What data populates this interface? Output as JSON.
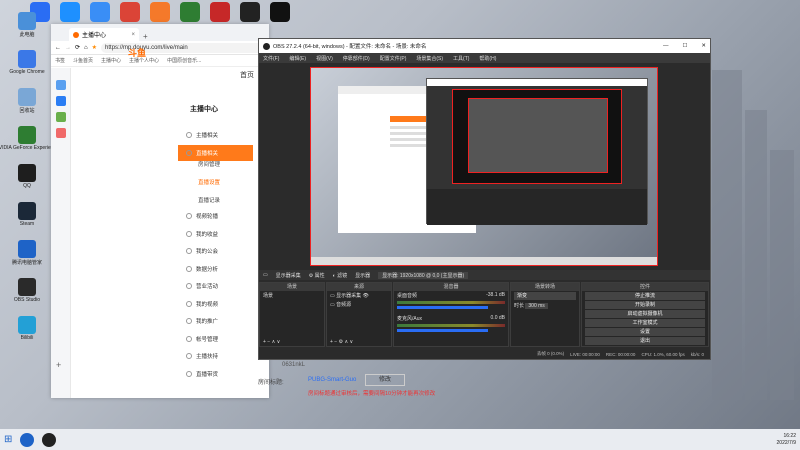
{
  "desktop": {
    "top_icons": [
      {
        "name": "app-icon",
        "color": "#2a6df4"
      },
      {
        "name": "feather-icon",
        "color": "#1e90ff"
      },
      {
        "name": "baidu-netdisk-icon",
        "color": "#3a8ef6"
      },
      {
        "name": "chrome-icon",
        "color": "#db4437"
      },
      {
        "name": "blender-icon",
        "color": "#f5792a"
      },
      {
        "name": "vegas-icon",
        "color": "#2e7d32"
      },
      {
        "name": "apex-icon",
        "color": "#c62828"
      },
      {
        "name": "epic-icon",
        "color": "#222222"
      },
      {
        "name": "mic-icon",
        "color": "#111111"
      }
    ],
    "left_icons": [
      {
        "label": "此电脑",
        "color": "#4a90d9"
      },
      {
        "label": "Google Chrome",
        "color": "#3b78e7"
      },
      {
        "label": "回收站",
        "color": "#7aa7d6"
      },
      {
        "label": "NVIDIA GeForce Experience",
        "color": "#2e7d32"
      },
      {
        "label": "QQ",
        "color": "#1e1e1e"
      },
      {
        "label": "Steam",
        "color": "#1b2838"
      },
      {
        "label": "腾讯电脑管家",
        "color": "#1e63c7"
      },
      {
        "label": "OBS Studio",
        "color": "#2a2a2a"
      },
      {
        "label": "Bilibili",
        "color": "#23a0d6"
      }
    ]
  },
  "browser": {
    "tab_title": "主播中心",
    "url": "https://mp.douyu.com/live/main",
    "bookmarks": [
      "书签",
      "斗鱼首页",
      "主播中心",
      "主播个人中心",
      "中国原创音乐..."
    ],
    "logo": "斗鱼",
    "nav_home": "首页",
    "menu_title": "主播中心",
    "menu": [
      {
        "label": "主播相关",
        "active": false
      },
      {
        "label": "直播相关",
        "active": true
      }
    ],
    "submenu": [
      {
        "label": "房间管理",
        "selected": false
      },
      {
        "label": "直播设置",
        "selected": true
      },
      {
        "label": "直播记录",
        "selected": false
      }
    ],
    "menu_more": [
      "视频轮播",
      "我的收益",
      "我的公会",
      "数据分析",
      "营业活动",
      "我的视频",
      "我的推广",
      "帐号管理",
      "主播扶持",
      "直播带货"
    ],
    "form": {
      "key_label": "0631nkL",
      "room_label": "房间标题:",
      "room_value": "PUBG-Smart-Guo",
      "edit_button": "修改",
      "warning": "房间标题通过审核后，需要间隔10分钟才能再次修改"
    }
  },
  "obs": {
    "title": "OBS 27.2.4 (64-bit, windows) - 配置文件: 未命名 - 场景: 未命名",
    "menu": [
      "文件(F)",
      "编辑(E)",
      "视图(V)",
      "停靠部件(D)",
      "配置文件(P)",
      "场景集合(S)",
      "工具(T)",
      "帮助(H)"
    ],
    "toolbar": {
      "capture_name": "显示器采集",
      "properties": "属性",
      "filters": "滤镜",
      "monitor_label": "显示器",
      "monitor_value": "显示器: 1920x1080 @ 0,0 (主显示器)"
    },
    "docks": {
      "scenes": {
        "title": "场景",
        "items": [
          "场景"
        ]
      },
      "sources": {
        "title": "来源",
        "items": [
          "显示器采集",
          "音频源"
        ]
      },
      "mixer": {
        "title": "混音器",
        "tracks": [
          {
            "name": "桌面音频",
            "level": "-38.1 dB"
          },
          {
            "name": "麦克风/Aux",
            "level": "0.0 dB"
          }
        ]
      },
      "transitions": {
        "title": "场景转场",
        "type": "渐变",
        "duration_label": "时长",
        "duration": "300 ms"
      },
      "controls": {
        "title": "控件",
        "buttons": [
          "停止推流",
          "开始录制",
          "启动虚拟摄像机",
          "工作室模式",
          "设置",
          "退出"
        ]
      }
    },
    "status": {
      "dropped": "丢帧 0 (0.0%)",
      "live": "LIVE: 00:00:00",
      "rec": "REC: 00:00:00",
      "cpu": "CPU: 1.0%, 60.00 fps",
      "bitrate": "kb/s: 0"
    }
  },
  "taskbar": {
    "time": "16:22",
    "date": "2022/7/9"
  }
}
